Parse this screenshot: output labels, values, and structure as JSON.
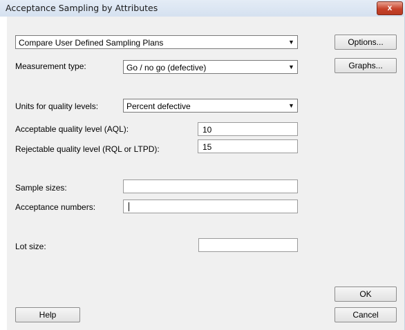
{
  "window": {
    "title": "Acceptance Sampling by Attributes",
    "close_label": "x"
  },
  "plan_select": {
    "value": "Compare User Defined Sampling Plans"
  },
  "measurement": {
    "label": "Measurement type:",
    "value": "Go / no go (defective)"
  },
  "units": {
    "label": "Units for quality levels:",
    "value": "Percent defective"
  },
  "aql": {
    "label": "Acceptable quality level (AQL):",
    "value": "10"
  },
  "rql": {
    "label": "Rejectable quality level (RQL or LTPD):",
    "value": "15"
  },
  "sample_sizes": {
    "label": "Sample sizes:",
    "value": ""
  },
  "acceptance_numbers": {
    "label": "Acceptance numbers:",
    "value": ""
  },
  "lot_size": {
    "label": "Lot size:",
    "value": ""
  },
  "buttons": {
    "options": "Options...",
    "graphs": "Graphs...",
    "ok": "OK",
    "cancel": "Cancel",
    "help": "Help"
  },
  "icons": {
    "dropdown": "chevron-down-icon",
    "close": "close-icon"
  },
  "colors": {
    "titlebar": "#d5e1f0",
    "client": "#f0f0f0",
    "close": "#c7432b"
  }
}
